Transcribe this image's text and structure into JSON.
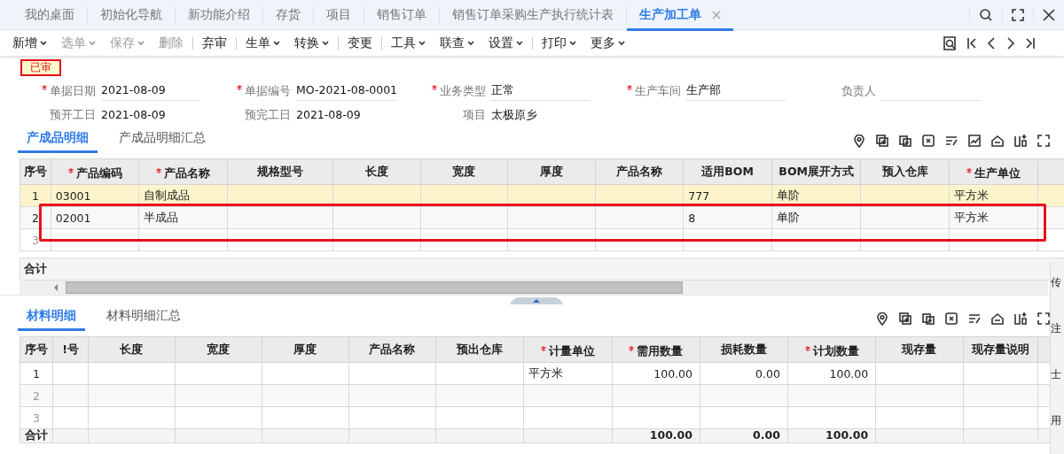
{
  "top_tabs": [
    {
      "label": "我的桌面",
      "selected": false,
      "closable": false
    },
    {
      "label": "初始化导航",
      "selected": false,
      "closable": false
    },
    {
      "label": "新功能介绍",
      "selected": false,
      "closable": false
    },
    {
      "label": "存货",
      "selected": false,
      "closable": false
    },
    {
      "label": "项目",
      "selected": false,
      "closable": false
    },
    {
      "label": "销售订单",
      "selected": false,
      "closable": false
    },
    {
      "label": "销售订单采购生产执行统计表",
      "selected": false,
      "closable": false
    },
    {
      "label": "生产加工单",
      "selected": true,
      "closable": true
    }
  ],
  "toolbar": [
    {
      "kind": "button",
      "label": "新增",
      "menu": true,
      "disabled": false
    },
    {
      "kind": "button",
      "label": "选单",
      "menu": true,
      "disabled": true
    },
    {
      "kind": "button",
      "label": "保存",
      "menu": true,
      "disabled": true
    },
    {
      "kind": "button",
      "label": "删除",
      "menu": false,
      "disabled": true
    },
    {
      "kind": "divider"
    },
    {
      "kind": "button",
      "label": "弃审",
      "menu": false,
      "disabled": false
    },
    {
      "kind": "divider"
    },
    {
      "kind": "button",
      "label": "生单",
      "menu": true,
      "disabled": false
    },
    {
      "kind": "button",
      "label": "转换",
      "menu": true,
      "disabled": false
    },
    {
      "kind": "divider"
    },
    {
      "kind": "button",
      "label": "变更",
      "menu": false,
      "disabled": false
    },
    {
      "kind": "divider"
    },
    {
      "kind": "button",
      "label": "工具",
      "menu": true,
      "disabled": false
    },
    {
      "kind": "button",
      "label": "联查",
      "menu": true,
      "disabled": false
    },
    {
      "kind": "button",
      "label": "设置",
      "menu": true,
      "disabled": false
    },
    {
      "kind": "divider"
    },
    {
      "kind": "button",
      "label": "打印",
      "menu": true,
      "disabled": false
    },
    {
      "kind": "button",
      "label": "更多",
      "menu": true,
      "disabled": false
    }
  ],
  "status_badge": "已审",
  "form_rows": [
    [
      {
        "label": "单据日期",
        "value": "2021-08-09",
        "required": true
      },
      {
        "label": "单据编号",
        "value": "MO-2021-08-0001",
        "required": true
      },
      {
        "label": "业务类型",
        "value": "正常",
        "required": true
      },
      {
        "label": "生产车间",
        "value": "生产部",
        "required": true
      },
      {
        "label": "负责人",
        "required": false
      }
    ],
    [
      {
        "label": "预开工日",
        "value": "2021-08-09",
        "required": false
      },
      {
        "label": "预完工日",
        "value": "2021-08-09",
        "required": false
      },
      {
        "label": "项目",
        "value": "太极原乡",
        "required": false
      }
    ]
  ],
  "sections": [
    {
      "tabs": [
        {
          "label": "产成品明细",
          "selected": true
        },
        {
          "label": "产成品明细汇总",
          "selected": false
        }
      ],
      "columns": [
        {
          "label": "序号",
          "required": false
        },
        {
          "label": "产品编码",
          "required": true
        },
        {
          "label": "产品名称",
          "required": true
        },
        {
          "label": "规格型号",
          "required": false
        },
        {
          "label": "长度",
          "required": false
        },
        {
          "label": "宽度",
          "required": false
        },
        {
          "label": "厚度",
          "required": false
        },
        {
          "label": "产品名称",
          "required": false
        },
        {
          "label": "适用BOM",
          "required": false
        },
        {
          "label": "BOM展开方式",
          "required": false
        },
        {
          "label": "预入仓库",
          "required": false
        },
        {
          "label": "生产单位",
          "required": true
        }
      ],
      "rows": [
        {
          "selected": true,
          "disabled": false,
          "cells": [
            "1",
            "03001",
            "自制成品",
            "",
            "",
            "",
            "",
            "",
            "777",
            "单阶",
            "",
            "平方米"
          ]
        },
        {
          "selected": false,
          "disabled": false,
          "cells": [
            "2",
            "02001",
            "半成品",
            "",
            "",
            "",
            "",
            "",
            "8",
            "单阶",
            "",
            "平方米"
          ]
        },
        {
          "selected": false,
          "disabled": true,
          "cells": [
            "3",
            "",
            "",
            "",
            "",
            "",
            "",
            "",
            "",
            "",
            "",
            ""
          ]
        }
      ],
      "totals": {
        "label": "合计"
      }
    },
    {
      "tabs": [
        {
          "label": "材料明细",
          "selected": true
        },
        {
          "label": "材料明细汇总",
          "selected": false
        }
      ],
      "columns": [
        {
          "label": "序号",
          "required": false
        },
        {
          "label": "!号",
          "required": false
        },
        {
          "label": "长度",
          "required": false
        },
        {
          "label": "宽度",
          "required": false
        },
        {
          "label": "厚度",
          "required": false
        },
        {
          "label": "产品名称",
          "required": false
        },
        {
          "label": "预出仓库",
          "required": false
        },
        {
          "label": "计量单位",
          "required": true
        },
        {
          "label": "需用数量",
          "required": true,
          "total": "100.00"
        },
        {
          "label": "损耗数量",
          "required": false,
          "total": "0.00"
        },
        {
          "label": "计划数量",
          "required": true,
          "total": "100.00"
        },
        {
          "label": "现存量",
          "required": false
        },
        {
          "label": "现存量说明",
          "required": false
        }
      ],
      "rows": [
        {
          "selected": false,
          "disabled": false,
          "cells": [
            "1",
            "",
            "",
            "",
            "",
            "",
            "",
            "平方米",
            "100.00",
            "0.00",
            "100.00",
            "",
            ""
          ]
        },
        {
          "selected": false,
          "disabled": true,
          "cells": [
            "2",
            "",
            "",
            "",
            "",
            "",
            "",
            "",
            "",
            "",
            "",
            "",
            ""
          ]
        },
        {
          "selected": false,
          "disabled": true,
          "cells": [
            "3",
            "",
            "",
            "",
            "",
            "",
            "",
            "",
            "",
            "",
            "",
            "",
            ""
          ]
        }
      ],
      "totals": {
        "label": "合计"
      }
    }
  ],
  "side_panel": [
    "传",
    "注",
    "士",
    "用"
  ]
}
